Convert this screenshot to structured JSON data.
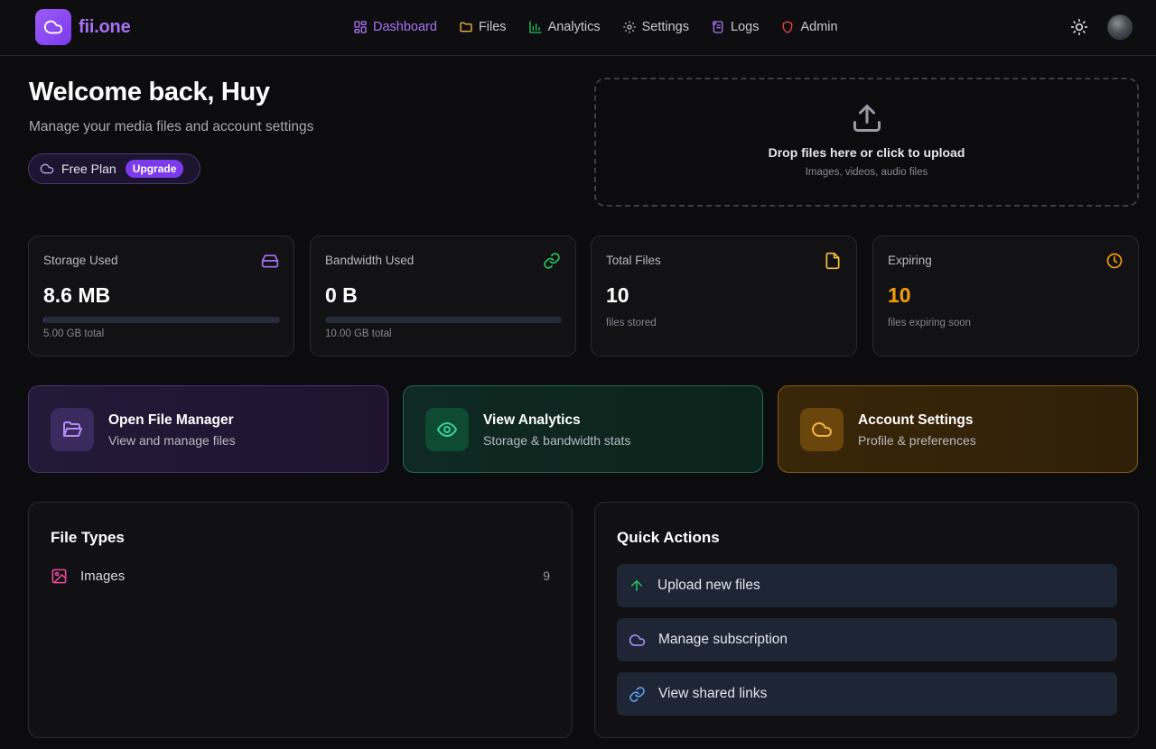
{
  "brand": {
    "name": "fii.one"
  },
  "nav": {
    "items": [
      {
        "label": "Dashboard",
        "icon": "dashboard-icon",
        "active": true
      },
      {
        "label": "Files",
        "icon": "folder-icon"
      },
      {
        "label": "Analytics",
        "icon": "bar-chart-icon"
      },
      {
        "label": "Settings",
        "icon": "gear-icon"
      },
      {
        "label": "Logs",
        "icon": "scroll-icon"
      },
      {
        "label": "Admin",
        "icon": "shield-icon"
      }
    ],
    "theme_toggle_icon": "sun-icon"
  },
  "welcome": {
    "title": "Welcome back, Huy",
    "subtitle": "Manage your media files and account settings",
    "plan_label": "Free Plan",
    "upgrade_label": "Upgrade"
  },
  "upload": {
    "title": "Drop files here or click to upload",
    "subtitle": "Images, videos, audio files"
  },
  "stats": [
    {
      "label": "Storage Used",
      "value": "8.6 MB",
      "foot": "5.00 GB total",
      "progress": 0.0017,
      "icon": "hard-drive-icon"
    },
    {
      "label": "Bandwidth Used",
      "value": "0 B",
      "foot": "10.00 GB total",
      "progress": 0,
      "icon": "link-icon"
    },
    {
      "label": "Total Files",
      "value": "10",
      "foot": "files stored",
      "icon": "file-icon"
    },
    {
      "label": "Expiring",
      "value": "10",
      "foot": "files expiring soon",
      "icon": "clock-icon"
    }
  ],
  "actions": [
    {
      "title": "Open File Manager",
      "subtitle": "View and manage files",
      "icon": "folder-open-icon"
    },
    {
      "title": "View Analytics",
      "subtitle": "Storage & bandwidth stats",
      "icon": "eye-icon"
    },
    {
      "title": "Account Settings",
      "subtitle": "Profile & preferences",
      "icon": "cloud-icon"
    }
  ],
  "file_types": {
    "title": "File Types",
    "items": [
      {
        "label": "Images",
        "count": "9",
        "icon": "image-icon"
      }
    ]
  },
  "quick_actions": {
    "title": "Quick Actions",
    "items": [
      {
        "label": "Upload new files",
        "icon": "arrow-up-icon"
      },
      {
        "label": "Manage subscription",
        "icon": "cloud-icon"
      },
      {
        "label": "View shared links",
        "icon": "link-icon"
      }
    ]
  },
  "colors": {
    "accent": "#7c3aed",
    "accent_text": "#a872f5",
    "green": "#22c55e",
    "amber": "#f59e0b",
    "pink": "#ec4899",
    "background": "#0c0c0e"
  }
}
